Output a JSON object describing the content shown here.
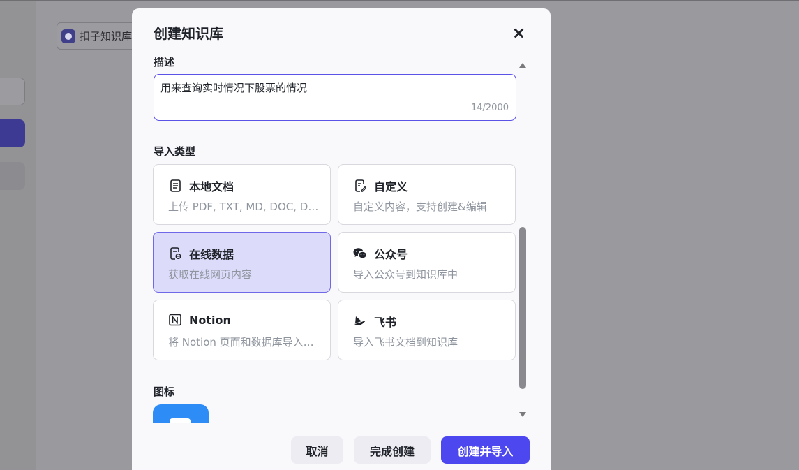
{
  "background": {
    "chip_label": "扣子知识库"
  },
  "modal": {
    "title": "创建知识库",
    "description": {
      "label": "描述",
      "value": "用来查询实时情况下股票的情况",
      "count": "14/2000"
    },
    "import_type": {
      "label": "导入类型",
      "cards": [
        {
          "title": "本地文档",
          "subtitle": "上传 PDF, TXT, MD, DOC, DOCX 格式的本地文件",
          "icon": "document-icon",
          "selected": false
        },
        {
          "title": "自定义",
          "subtitle": "自定义内容，支持创建&编辑",
          "icon": "edit-document-icon",
          "selected": false
        },
        {
          "title": "在线数据",
          "subtitle": "获取在线网页内容",
          "icon": "web-document-icon",
          "selected": true
        },
        {
          "title": "公众号",
          "subtitle": "导入公众号到知识库中",
          "icon": "wechat-icon",
          "selected": false
        },
        {
          "title": "Notion",
          "subtitle": "将 Notion 页面和数据库导入知识库中",
          "icon": "notion-icon",
          "selected": false
        },
        {
          "title": "飞书",
          "subtitle": "导入飞书文档到知识库",
          "icon": "feishu-icon",
          "selected": false
        }
      ]
    },
    "icon_section": {
      "label": "图标",
      "color": "#2e8cf6"
    },
    "buttons": {
      "cancel": "取消",
      "finish": "完成创建",
      "create_import": "创建并导入"
    }
  },
  "colors": {
    "accent": "#4d47ef",
    "selected_card_bg": "#dcdcfa"
  }
}
